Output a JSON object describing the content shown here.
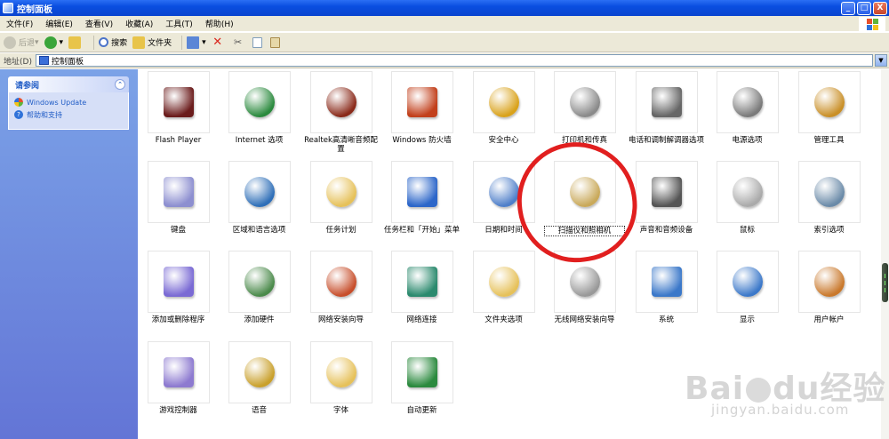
{
  "window": {
    "title": "控制面板",
    "buttons": {
      "minimize": "_",
      "maximize": "□",
      "close": "X"
    }
  },
  "menu": [
    "文件(F)",
    "编辑(E)",
    "查看(V)",
    "收藏(A)",
    "工具(T)",
    "帮助(H)"
  ],
  "toolbar": {
    "back": "后退",
    "search": "搜索",
    "folders": "文件夹"
  },
  "address": {
    "label": "地址(D)",
    "value": "控制面板"
  },
  "taskpane": {
    "title": "请参阅",
    "collapse": "⌃",
    "links": [
      "Windows Update",
      "帮助和支持"
    ]
  },
  "items": [
    {
      "label": "Flash Player",
      "icon": "flash-player-icon",
      "color": "#6b1c1c"
    },
    {
      "label": "Internet 选项",
      "icon": "globe-icon",
      "color": "#2b8a3e"
    },
    {
      "label": "Realtek高清晰音频配置",
      "icon": "speaker-icon",
      "color": "#8a2a1a"
    },
    {
      "label": "Windows 防火墙",
      "icon": "firewall-icon",
      "color": "#c2401c"
    },
    {
      "label": "安全中心",
      "icon": "shield-icon",
      "color": "#d9a21b"
    },
    {
      "label": "打印机和传真",
      "icon": "printer-icon",
      "color": "#8a8a8a"
    },
    {
      "label": "电话和调制解调器选项",
      "icon": "phone-icon",
      "color": "#666"
    },
    {
      "label": "电源选项",
      "icon": "power-icon",
      "color": "#7a7a7a"
    },
    {
      "label": "管理工具",
      "icon": "admin-tools-icon",
      "color": "#c98f27"
    },
    {
      "label": "键盘",
      "icon": "keyboard-icon",
      "color": "#8d8fd0"
    },
    {
      "label": "区域和语言选项",
      "icon": "globe-icon",
      "color": "#2f6fb8"
    },
    {
      "label": "任务计划",
      "icon": "task-folder-icon",
      "color": "#e6c15a"
    },
    {
      "label": "任务栏和「开始」菜单",
      "icon": "taskbar-icon",
      "color": "#2c66c9"
    },
    {
      "label": "日期和时间",
      "icon": "clock-icon",
      "color": "#4f7fc9"
    },
    {
      "label": "扫描仪和照相机",
      "icon": "scanner-camera-icon",
      "color": "#c9a95a"
    },
    {
      "label": "声音和音频设备",
      "icon": "speaker-icon",
      "color": "#555"
    },
    {
      "label": "鼠标",
      "icon": "mouse-icon",
      "color": "#aaa"
    },
    {
      "label": "索引选项",
      "icon": "search-index-icon",
      "color": "#6a8aa8"
    },
    {
      "label": "添加或删除程序",
      "icon": "cd-install-icon",
      "color": "#7a6ad4"
    },
    {
      "label": "添加硬件",
      "icon": "hardware-icon",
      "color": "#4b8a4b"
    },
    {
      "label": "网络安装向导",
      "icon": "home-network-icon",
      "color": "#c74e2b"
    },
    {
      "label": "网络连接",
      "icon": "network-globe-icon",
      "color": "#2b8a6e"
    },
    {
      "label": "文件夹选项",
      "icon": "folder-check-icon",
      "color": "#e6c15a"
    },
    {
      "label": "无线网络安装向导",
      "icon": "usb-wireless-icon",
      "color": "#999"
    },
    {
      "label": "系统",
      "icon": "monitor-check-icon",
      "color": "#3b78c9"
    },
    {
      "label": "显示",
      "icon": "display-icon",
      "color": "#3b78c9"
    },
    {
      "label": "用户帐户",
      "icon": "users-icon",
      "color": "#c9782b"
    },
    {
      "label": "游戏控制器",
      "icon": "gamepad-icon",
      "color": "#8d7ad0"
    },
    {
      "label": "语音",
      "icon": "speech-icon",
      "color": "#c9a02b"
    },
    {
      "label": "字体",
      "icon": "fonts-folder-icon",
      "color": "#e6c15a"
    },
    {
      "label": "自动更新",
      "icon": "windows-update-icon",
      "color": "#2b8a3e"
    }
  ],
  "selected_index": 14,
  "watermark": {
    "brand": "Bai",
    "brand2": "du",
    "cn": "经验",
    "url": "jingyan.baidu.com"
  }
}
